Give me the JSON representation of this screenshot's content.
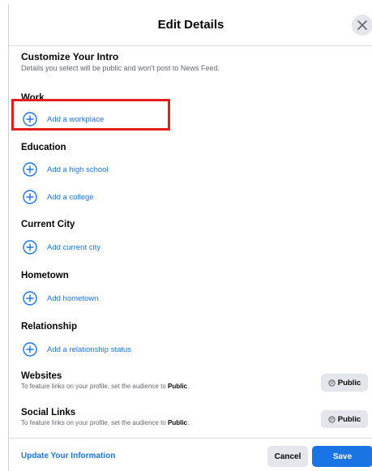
{
  "dialog": {
    "title": "Edit Details"
  },
  "intro": {
    "heading": "Customize Your Intro",
    "subtitle": "Details you select will be public and won't post to News Feed."
  },
  "sections": {
    "work": {
      "title": "Work",
      "add_workplace": "Add a workplace"
    },
    "education": {
      "title": "Education",
      "add_high_school": "Add a high school",
      "add_college": "Add a college"
    },
    "current_city": {
      "title": "Current City",
      "add": "Add current city"
    },
    "hometown": {
      "title": "Hometown",
      "add": "Add hometown"
    },
    "relationship": {
      "title": "Relationship",
      "add": "Add a relationship status"
    },
    "websites": {
      "title": "Websites",
      "note_prefix": "To feature links on your profile, set the audience to ",
      "note_bold": "Public",
      "note_suffix": ".",
      "audience_button": "Public"
    },
    "social_links": {
      "title": "Social Links",
      "note_prefix": "To feature links on your profile, set the audience to ",
      "note_bold": "Public",
      "note_suffix": ".",
      "audience_button": "Public"
    }
  },
  "footer": {
    "update_link": "Update Your Information",
    "cancel": "Cancel",
    "save": "Save"
  },
  "colors": {
    "accent": "#1b74e4",
    "highlight": "#e41e1e",
    "button_gray": "#e4e6eb"
  }
}
